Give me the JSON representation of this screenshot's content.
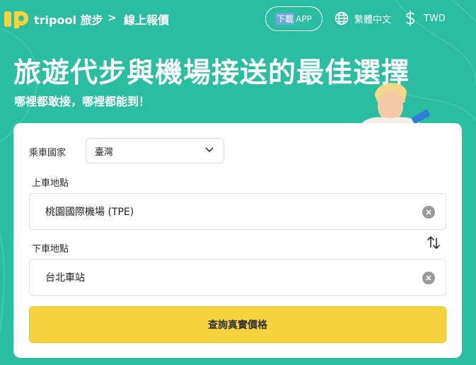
{
  "header": {
    "brand": "tripool 旅步",
    "breadcrumb": "線上報價",
    "download_prefix": "下載",
    "download_suffix": "APP",
    "language": "繁體中文",
    "currency": "TWD"
  },
  "hero": {
    "title": "旅遊代步與機場接送的最佳選擇",
    "subtitle": "哪裡都敢接，哪裡都能到！"
  },
  "form": {
    "country_label": "乘車國家",
    "country_value": "臺灣",
    "pickup_label": "上車地點",
    "pickup_value": "桃園國際機場 (TPE)",
    "dropoff_label": "下車地點",
    "dropoff_value": "台北車站",
    "submit_label": "查詢真實價格"
  },
  "icons": {
    "logo": "tripool-logo",
    "breadcrumb_separator": "chevron-right-icon",
    "language": "globe-icon",
    "currency": "dollar-icon",
    "select": "chevron-down-icon",
    "clear": "clear-icon",
    "swap": "swap-icon"
  },
  "colors": {
    "background": "#2bbd9f",
    "accent_button": "#f7d43e",
    "card": "#ffffff",
    "clear_icon": "#9a9a9a"
  }
}
